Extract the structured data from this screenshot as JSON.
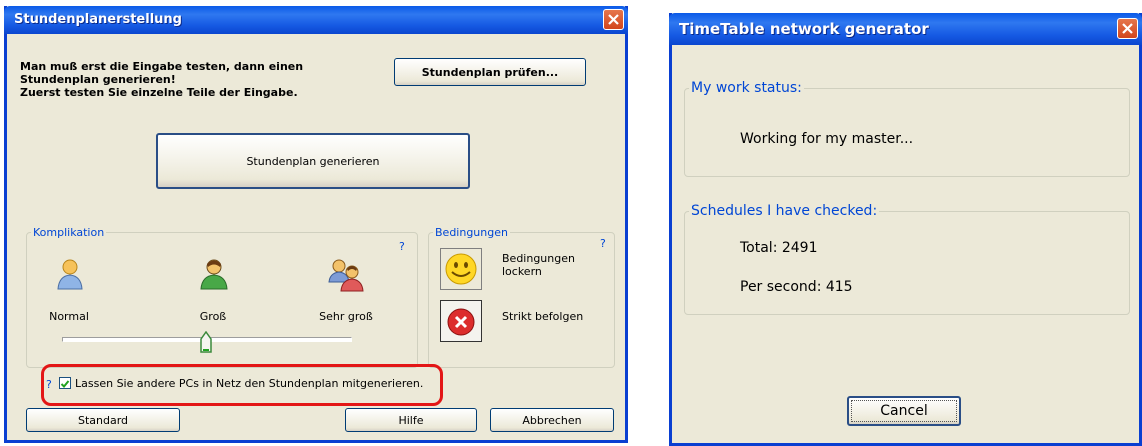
{
  "left_window": {
    "title": "Stundenplanerstellung",
    "intro_line1": "Man muß erst die Eingabe testen, dann einen",
    "intro_line2": "Stundenplan generieren!",
    "intro_line3": "Zuerst testen Sie einzelne Teile der Eingabe.",
    "check_button": "Stundenplan prüfen...",
    "generate_button": "Stundenplan generieren",
    "complication": {
      "legend": "Komplikation",
      "help": "?",
      "levels": [
        {
          "label": "Normal",
          "icon": "single-person-icon"
        },
        {
          "label": "Groß",
          "icon": "green-person-icon"
        },
        {
          "label": "Sehr groß",
          "icon": "group-persons-icon"
        }
      ],
      "slider_value": "Groß"
    },
    "conditions": {
      "legend": "Bedingungen",
      "help": "?",
      "relax_label": "Bedingungen lockern",
      "relax_line1": "Bedingungen",
      "relax_line2": "lockern",
      "strict_label": "Strikt befolgen"
    },
    "network_checkbox": {
      "help": "?",
      "checked": true,
      "label": "Lassen Sie andere PCs in Netz den Stundenplan mitgenerieren."
    },
    "buttons": {
      "standard": "Standard",
      "help": "Hilfe",
      "cancel": "Abbrechen"
    }
  },
  "right_window": {
    "title": "TimeTable network generator",
    "status_legend": "My work status:",
    "status_text": "Working for my master...",
    "schedules_legend": "Schedules I have checked:",
    "total": "Total: 2491",
    "per_second": "Per second: 415",
    "cancel": "Cancel"
  },
  "colors": {
    "titlebar": "#0a5ae8",
    "legend": "#0046d5",
    "highlight": "#e31616"
  }
}
